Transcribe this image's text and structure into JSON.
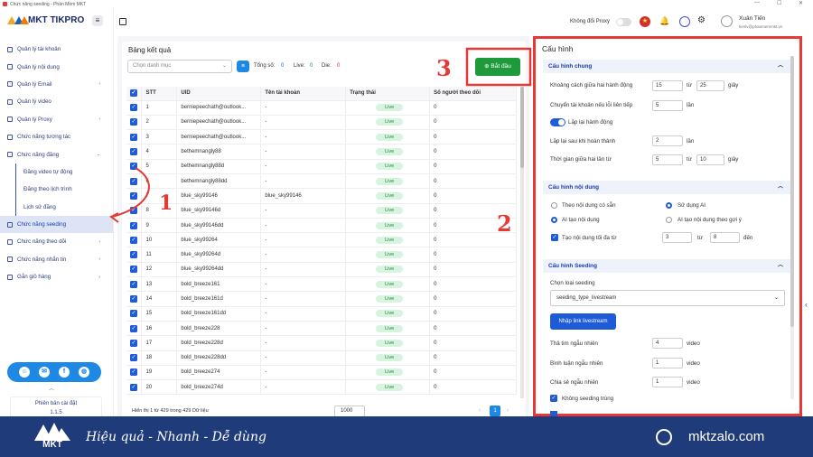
{
  "window": {
    "title": "Chức năng seeding - Phần Mềm MKT"
  },
  "app": {
    "logo": "MKT TIKPRO"
  },
  "header": {
    "proxy_label": "Không đổi Proxy",
    "user_name": "Xuân Tiến",
    "user_email": "tienlv@phanmemmkt.vn"
  },
  "sidebar": {
    "items": [
      {
        "label": "Quản lý tài khoản",
        "chev": ""
      },
      {
        "label": "Quản lý nội dung",
        "chev": ""
      },
      {
        "label": "Quản lý Email",
        "chev": "›"
      },
      {
        "label": "Quản lý video",
        "chev": ""
      },
      {
        "label": "Quản lý Proxy",
        "chev": "›"
      },
      {
        "label": "Chức năng tương tác",
        "chev": ""
      },
      {
        "label": "Chức năng đăng",
        "chev": "⌄"
      },
      {
        "label": "Đăng video tự động",
        "chev": ""
      },
      {
        "label": "Đăng theo lịch trình",
        "chev": ""
      },
      {
        "label": "Lịch sử đăng",
        "chev": ""
      },
      {
        "label": "Chức năng seeding",
        "chev": ""
      },
      {
        "label": "Chức năng theo dõi",
        "chev": "›"
      },
      {
        "label": "Chức năng nhắn tin",
        "chev": "›"
      },
      {
        "label": "Gắn giỏ hàng",
        "chev": "›"
      }
    ],
    "version_label": "Phiên bản cài đặt",
    "version": "1.1.5"
  },
  "results": {
    "title": "Bảng kết quả",
    "category_placeholder": "Chọn danh mục",
    "total_label": "Tổng số:",
    "total": "0",
    "live_label": "Live:",
    "live": "0",
    "die_label": "Die:",
    "die": "0",
    "start_button": "Bắt đầu",
    "columns": [
      "STT",
      "UID",
      "Tên tài khoản",
      "Trạng thái",
      "Số người theo dõi"
    ],
    "rows": [
      [
        "1",
        "berniepeechath@outlook...",
        "-",
        "Live",
        "0"
      ],
      [
        "2",
        "berniepeechath@outlook...",
        "-",
        "Live",
        "0"
      ],
      [
        "3",
        "berniepeechath@outlook...",
        "-",
        "Live",
        "0"
      ],
      [
        "4",
        "bethemnangly88",
        "-",
        "Live",
        "0"
      ],
      [
        "5",
        "bethemnangly88d",
        "-",
        "Live",
        "0"
      ],
      [
        "6",
        "bethemnangly88dd",
        "-",
        "Live",
        "0"
      ],
      [
        "7",
        "blue_sky99146",
        "blue_sky99146",
        "Live",
        "0"
      ],
      [
        "8",
        "blue_sky99146d",
        "-",
        "Live",
        "0"
      ],
      [
        "9",
        "blue_sky99146dd",
        "-",
        "Live",
        "0"
      ],
      [
        "10",
        "blue_sky99264",
        "-",
        "Live",
        "0"
      ],
      [
        "11",
        "blue_sky99264d",
        "-",
        "Live",
        "0"
      ],
      [
        "12",
        "blue_sky99264dd",
        "-",
        "Live",
        "0"
      ],
      [
        "13",
        "bold_breeze161",
        "-",
        "Live",
        "0"
      ],
      [
        "14",
        "bold_breeze161d",
        "-",
        "Live",
        "0"
      ],
      [
        "15",
        "bold_breeze161dd",
        "-",
        "Live",
        "0"
      ],
      [
        "16",
        "bold_breeze228",
        "-",
        "Live",
        "0"
      ],
      [
        "17",
        "bold_breeze228d",
        "-",
        "Live",
        "0"
      ],
      [
        "18",
        "bold_breeze228dd",
        "-",
        "Live",
        "0"
      ],
      [
        "19",
        "bold_breeze274",
        "-",
        "Live",
        "0"
      ],
      [
        "20",
        "bold_breeze274d",
        "-",
        "Live",
        "0"
      ]
    ],
    "footer_text": "Hiển thị 1 từ 429 trong 429 Dữ liệu",
    "page_size": "1000",
    "current_page": "1"
  },
  "config": {
    "title": "Cấu hình",
    "general": {
      "title": "Cấu hình chung",
      "interval_label": "Khoảng cách giữa hai hành động",
      "interval_from": "15",
      "interval_to": "25",
      "interval_unit": "giây",
      "to_word": "từ",
      "switch_label": "Chuyển tài khoản nếu lỗi liên tiếp",
      "switch_value": "5",
      "switch_unit": "lần",
      "repeat_label": "Lặp lại hành động",
      "repeat_after_label": "Lặp lại sau khi hoàn thành",
      "repeat_after_value": "2",
      "repeat_after_unit": "lần",
      "wait_label": "Thời gian giữa hai lần từ",
      "wait_from": "5",
      "wait_to": "10",
      "wait_unit": "giây"
    },
    "content": {
      "title": "Cấu hình nội dung",
      "opt1": "Theo nội dung có sẵn",
      "opt2": "Sử dụng AI",
      "opt3": "AI tạo nội dung",
      "opt4": "AI tạo nội dung theo gợi ý",
      "max_label": "Tạo nội dung tối đa từ",
      "max_from": "3",
      "max_to_word": "từ",
      "max_to": "8",
      "max_unit": "đến"
    },
    "seeding": {
      "title": "Cấu hình Seeding",
      "type_label": "Chọn loại seeding",
      "type_value": "seeding_type_livestream",
      "link_button": "Nhập link livestream",
      "heart_label": "Thả tim ngẫu nhiên",
      "heart_value": "4",
      "heart_unit": "video",
      "comment_label": "Bình luận ngẫu nhiên",
      "comment_value": "1",
      "comment_unit": "video",
      "share_label": "Chia sẻ ngẫu nhiên",
      "share_value": "1",
      "share_unit": "video",
      "nodup_label": "Không seeding trùng"
    }
  },
  "annotations": {
    "n1": "1",
    "n2": "2",
    "n3": "3"
  },
  "banner": {
    "brand": "MKT",
    "slogan": "Hiệu quả - Nhanh - Dễ dùng",
    "site": "mktzalo.com"
  },
  "colors": {
    "primary": "#1e5bd6",
    "nav": "#2c3e7a",
    "annotation": "#e53935",
    "start": "#1e9a3a",
    "banner": "#1f3b7a",
    "live_bg": "#d8f3df"
  }
}
